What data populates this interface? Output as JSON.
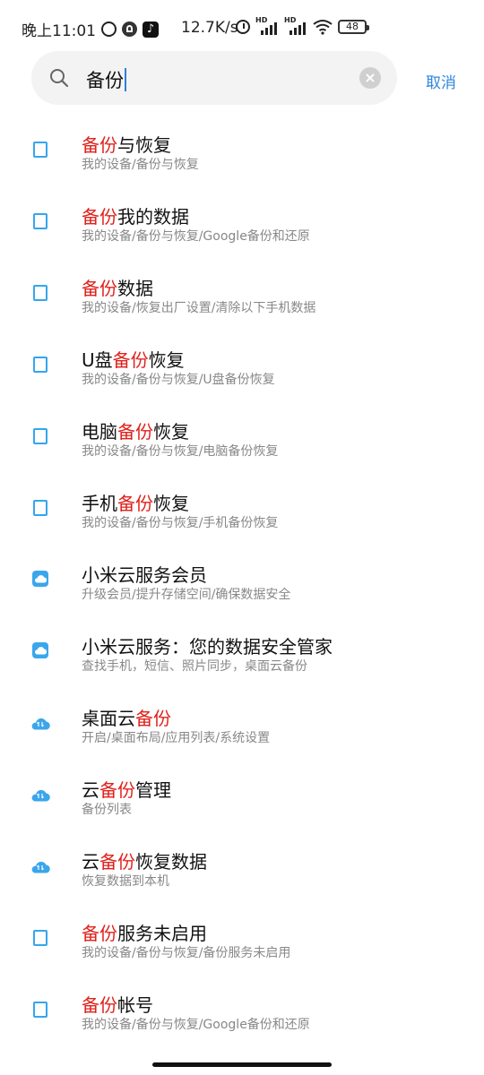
{
  "status_bar": {
    "time": "晚上11:01",
    "net_speed": "12.7K/s",
    "hd_label": "HD",
    "battery": "48",
    "tiktok_glyph": "♪"
  },
  "search": {
    "query": "备份",
    "clear_glyph": "×",
    "cancel_label": "取消"
  },
  "colors": {
    "accent": "#2e87de",
    "highlight": "#e0211b",
    "icon_blue": "#36a5ee"
  },
  "results": [
    {
      "pre": "",
      "hl": "备份",
      "post": "与恢复",
      "sub": "我的设备/备份与恢复",
      "icon": "phone-icon"
    },
    {
      "pre": "",
      "hl": "备份",
      "post": "我的数据",
      "sub": "我的设备/备份与恢复/Google备份和还原",
      "icon": "phone-icon"
    },
    {
      "pre": "",
      "hl": "备份",
      "post": "数据",
      "sub": "我的设备/恢复出厂设置/清除以下手机数据",
      "icon": "phone-icon"
    },
    {
      "pre": "U盘",
      "hl": "备份",
      "post": "恢复",
      "sub": "我的设备/备份与恢复/U盘备份恢复",
      "icon": "phone-icon"
    },
    {
      "pre": "电脑",
      "hl": "备份",
      "post": "恢复",
      "sub": "我的设备/备份与恢复/电脑备份恢复",
      "icon": "phone-icon"
    },
    {
      "pre": "手机",
      "hl": "备份",
      "post": "恢复",
      "sub": "我的设备/备份与恢复/手机备份恢复",
      "icon": "phone-icon"
    },
    {
      "pre": "小米云服务会员",
      "hl": "",
      "post": "",
      "sub": "升级会员/提升存储空间/确保数据安全",
      "icon": "mi-cloud-icon"
    },
    {
      "pre": "小米云服务：您的数据安全管家",
      "hl": "",
      "post": "",
      "sub": "查找手机，短信、照片同步，桌面云备份",
      "icon": "mi-cloud-icon"
    },
    {
      "pre": "桌面云",
      "hl": "备份",
      "post": "",
      "sub": "开启/桌面布局/应用列表/系统设置",
      "icon": "cloud-sync-icon"
    },
    {
      "pre": "云",
      "hl": "备份",
      "post": "管理",
      "sub": "备份列表",
      "icon": "cloud-sync-icon"
    },
    {
      "pre": "云",
      "hl": "备份",
      "post": "恢复数据",
      "sub": "恢复数据到本机",
      "icon": "cloud-sync-icon"
    },
    {
      "pre": "",
      "hl": "备份",
      "post": "服务未启用",
      "sub": "我的设备/备份与恢复/备份服务未启用",
      "icon": "phone-icon"
    },
    {
      "pre": "",
      "hl": "备份",
      "post": "帐号",
      "sub": "我的设备/备份与恢复/Google备份和还原",
      "icon": "phone-icon"
    }
  ]
}
